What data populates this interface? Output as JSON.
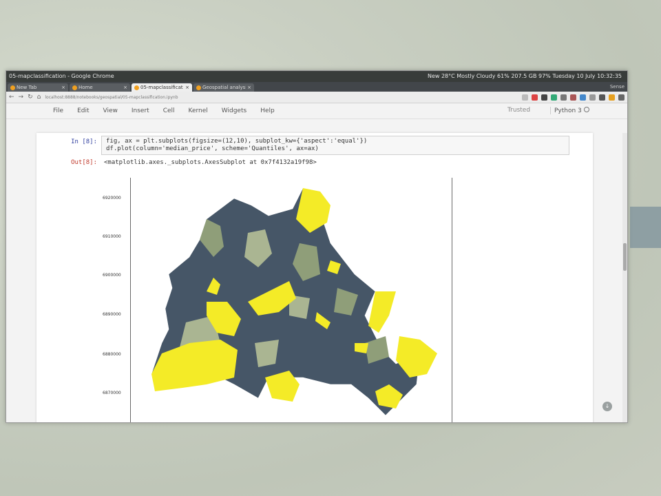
{
  "system": {
    "window_title": "05-mapclassification - Google Chrome",
    "status": "New  28°C Mostly Cloudy  61%  207.5 GB  97%  Tuesday 10 July  10:32:35"
  },
  "tabs": [
    {
      "label": "New Tab",
      "active": false
    },
    {
      "label": "Home",
      "active": false
    },
    {
      "label": "05-mapclassificat",
      "active": true
    },
    {
      "label": "Geospatial analysis",
      "active": false
    }
  ],
  "tabbar_extra": "Sense",
  "address": {
    "url": "localhost:8888/notebooks/geospatial/05-mapclassification.ipynb"
  },
  "menu": [
    "File",
    "Edit",
    "View",
    "Insert",
    "Cell",
    "Kernel",
    "Widgets",
    "Help"
  ],
  "notebook": {
    "trusted": "Trusted",
    "kernel": "Python 3",
    "in_prompt": "In [8]:",
    "code_lines": [
      "fig, ax = plt.subplots(figsize=(12,10), subplot_kw={'aspect':'equal'})",
      "df.plot(column='median_price', scheme='Quantiles', ax=ax)"
    ],
    "out_prompt": "Out[8]:",
    "out_text": "<matplotlib.axes._subplots.AxesSubplot at 0x7f4132a19f98>"
  },
  "plot": {
    "yticks": [
      "6920000",
      "6910000",
      "6900000",
      "6890000",
      "6880000",
      "6870000"
    ],
    "colors": {
      "dark": "#465667",
      "mid": "#8f9e79",
      "light": "#aab592",
      "yellow": "#f4eb27"
    }
  }
}
